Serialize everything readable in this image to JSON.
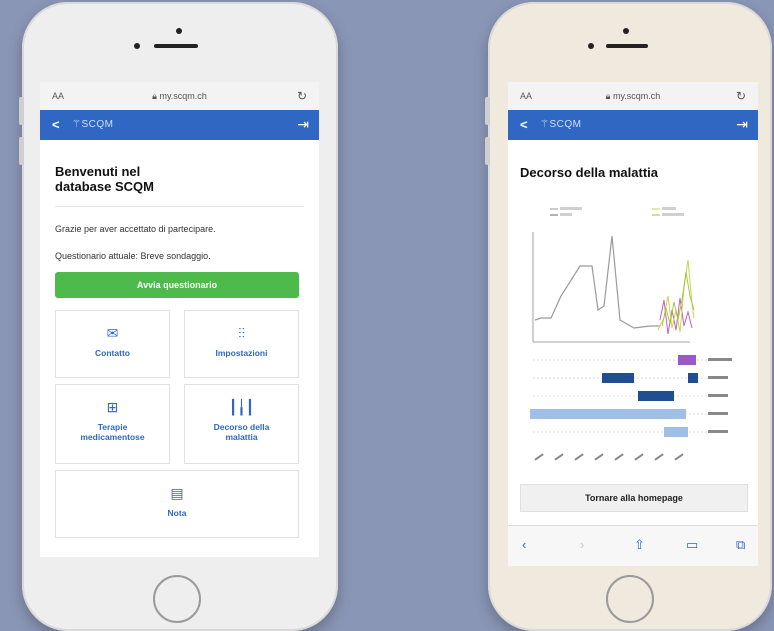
{
  "colors": {
    "background": "#8a96b6",
    "brand": "#2f67c2",
    "cta": "#4fba4c"
  },
  "left_phone": {
    "browser": {
      "text_size": "AA",
      "url": "my.scqm.ch"
    },
    "app": {
      "logo": "SCQM"
    },
    "heading": {
      "line1": "Benvenuti nel",
      "line2": "database SCQM"
    },
    "thanks": "Grazie per aver accettato di partecipare.",
    "current_questionnaire": "Questionario attuale: Breve sondaggio.",
    "start_button": "Avvia questionario",
    "tiles": {
      "contact": "Contatto",
      "settings": "Impostazioni",
      "therapy_line1": "Terapie",
      "therapy_line2": "medicamentose",
      "course_line1": "Decorso della",
      "course_line2": "malattia",
      "notes": "Nota"
    }
  },
  "right_phone": {
    "browser": {
      "text_size": "AA",
      "url": "my.scqm.ch"
    },
    "app": {
      "logo": "SCQM"
    },
    "heading": "Decorso della malattia",
    "home_button": "Tornare alla homepage"
  }
}
